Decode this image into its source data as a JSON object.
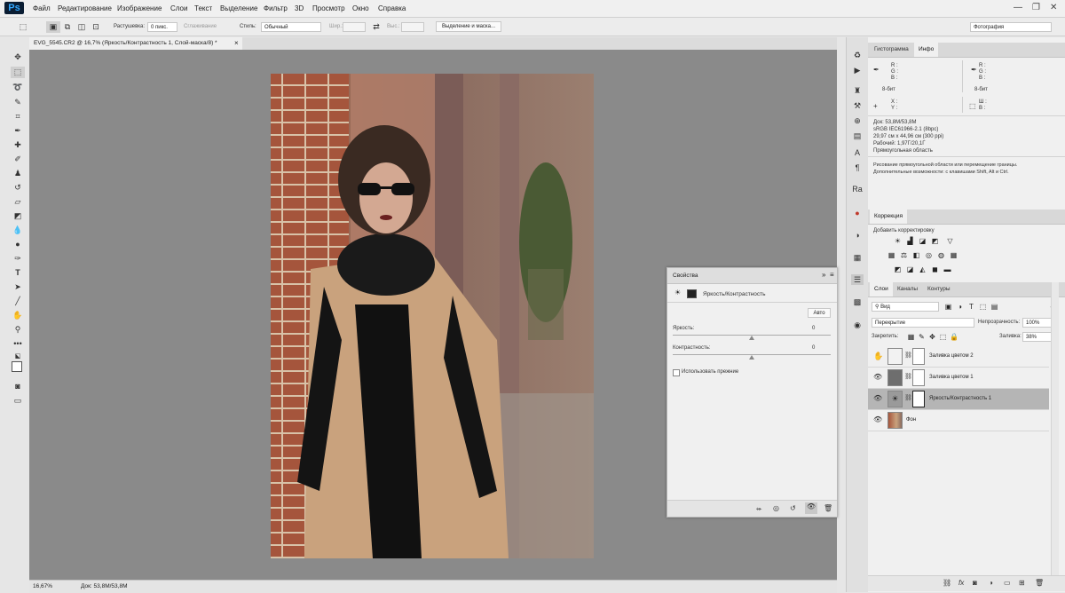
{
  "app": {
    "logo": "Ps"
  },
  "menu": [
    "Файл",
    "Редактирование",
    "Изображение",
    "Слои",
    "Текст",
    "Выделение",
    "Фильтр",
    "3D",
    "Просмотр",
    "Окно",
    "Справка"
  ],
  "window_controls": {
    "minimize": "—",
    "restore": "❐",
    "close": "✕"
  },
  "options": {
    "feather_label": "Растушевка:",
    "feather_value": "0 пикс.",
    "antialias_label": "Сглаживание",
    "style_label": "Стиль:",
    "style_value": "Обычный",
    "width_label": "Шир.:",
    "height_label": "Выс.:",
    "select_mask_button": "Выделение и маска...",
    "workspace": "Фотография"
  },
  "document": {
    "tab_title": "EVG_5545.CR2 @ 16,7% (Яркость/Контрастность 1, Слой-маска/8) *",
    "tab_close": "×",
    "zoom": "16,67%",
    "doc_size": "Док: 53,8M/53,8M"
  },
  "info_panel": {
    "tabs": [
      "Гистограмма",
      "Инфо"
    ],
    "active_tab": 1,
    "rgb_labels": [
      "R :",
      "G :",
      "B :"
    ],
    "bit_left": "8-бит",
    "bit_right": "8-бит",
    "xy_labels": [
      "X :",
      "Y :"
    ],
    "wh_labels": [
      "Ш :",
      "В :"
    ],
    "doc_lines": [
      "Док: 53,8M/53,8M",
      "sRGB IEC61966-2.1 (8bpc)",
      "29,97 см x 44,96 см (300 ppi)",
      "Рабочий: 1,97Г/20,1Г",
      "Прямоугольная область"
    ],
    "hint_lines": [
      "Рисование прямоугольной области или перемещение границы.",
      "Дополнительные возможности: с клавишами Shift, Alt и Ctrl."
    ]
  },
  "corrections": {
    "title": "Коррекция",
    "subtitle": "Добавить корректировку"
  },
  "layers_panel": {
    "tabs": [
      "Слои",
      "Каналы",
      "Контуры"
    ],
    "active_tab": 0,
    "filter": "Вид",
    "blend_mode": "Перекрытие",
    "opacity_label": "Непрозрачность:",
    "opacity_value": "100%",
    "lock_label": "Закрепить:",
    "fill_label": "Заливка:",
    "fill_value": "38%",
    "layers": [
      {
        "name": "Заливка цветом 2",
        "thumb": "#f2f2f2",
        "visible": false,
        "selected": false,
        "type": "fill"
      },
      {
        "name": "Заливка цветом 1",
        "thumb": "#6e6e6e",
        "visible": true,
        "selected": false,
        "type": "fill"
      },
      {
        "name": "Яркость/Контрастность 1",
        "thumb": "adjust",
        "visible": true,
        "selected": true,
        "type": "adjustment"
      },
      {
        "name": "Фон",
        "thumb": "photo",
        "visible": true,
        "selected": false,
        "type": "background"
      }
    ]
  },
  "properties_panel": {
    "title": "Свойства",
    "collapse": "»",
    "menu": "≡",
    "adjustment_name": "Яркость/Контрастность",
    "auto_button": "Авто",
    "brightness_label": "Яркость:",
    "brightness_value": "0",
    "contrast_label": "Контрастность:",
    "contrast_value": "0",
    "legacy_label": "Использовать прежние"
  },
  "colors": {
    "accent": "#31a8ff",
    "canvas_bg": "#8a8a8a",
    "panel_bg": "#f0f0f0"
  }
}
